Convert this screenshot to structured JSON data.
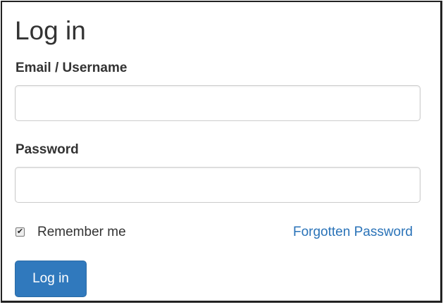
{
  "form": {
    "title": "Log in",
    "email": {
      "label": "Email / Username",
      "value": "",
      "placeholder": ""
    },
    "password": {
      "label": "Password",
      "value": "",
      "placeholder": ""
    },
    "remember": {
      "label": "Remember me",
      "checked": true,
      "check_glyph": "✔"
    },
    "forgot_link": "Forgotten Password",
    "submit_label": "Log in"
  },
  "icons": {
    "checkbox": "checkmark-icon"
  },
  "colors": {
    "link": "#2a73b8",
    "primary_button": "#3079bd",
    "text": "#333333",
    "field_border": "#cccccc"
  }
}
